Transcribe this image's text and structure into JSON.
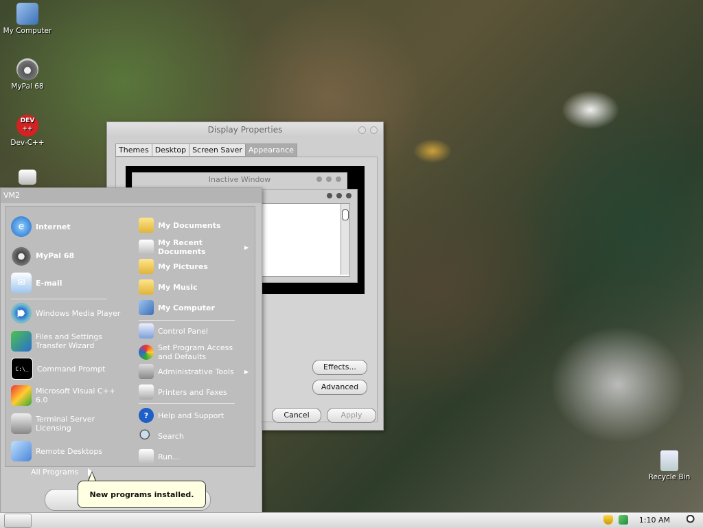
{
  "desktop": {
    "icons": [
      {
        "label": "My Computer",
        "icon": "computer-icon"
      },
      {
        "label": "MyPal 68",
        "icon": "raccoon-icon"
      },
      {
        "label": "Dev-C++",
        "icon": "devcpp-icon",
        "badge": "DEV ++"
      },
      {
        "label": "",
        "icon": "printer-icon"
      },
      {
        "label": "Recycle Bin",
        "icon": "recycle-bin-icon"
      }
    ]
  },
  "display_properties": {
    "title": "Display Properties",
    "tabs": [
      "Themes",
      "Desktop",
      "Screen Saver",
      "Appearance"
    ],
    "active_tab": "Appearance",
    "preview": {
      "inactive_title": "Inactive Window"
    },
    "buttons": {
      "effects": "Effects...",
      "advanced": "Advanced",
      "cancel": "Cancel",
      "apply": "Apply"
    }
  },
  "start_menu": {
    "user": "VM2",
    "pinned": [
      {
        "label": "Internet",
        "icon": "internet-explorer-icon"
      },
      {
        "label": "MyPal 68",
        "icon": "raccoon-icon"
      },
      {
        "label": "E-mail",
        "icon": "email-icon"
      }
    ],
    "recent": [
      {
        "label": "Windows Media Player",
        "icon": "media-player-icon"
      },
      {
        "label": "Files and Settings Transfer Wizard",
        "icon": "transfer-wizard-icon"
      },
      {
        "label": "Command Prompt",
        "icon": "command-prompt-icon",
        "glyph": "C:\\_"
      },
      {
        "label": "Microsoft Visual C++ 6.0",
        "icon": "visual-cpp-icon"
      },
      {
        "label": "Terminal Server Licensing",
        "icon": "terminal-server-icon"
      },
      {
        "label": "Remote Desktops",
        "icon": "remote-desktops-icon"
      }
    ],
    "all_programs": "All Programs",
    "right": [
      {
        "label": "My Documents",
        "icon": "folder-documents-icon"
      },
      {
        "label": "My Recent Documents",
        "icon": "recent-documents-icon",
        "submenu": true
      },
      {
        "label": "My Pictures",
        "icon": "folder-pictures-icon"
      },
      {
        "label": "My Music",
        "icon": "folder-music-icon"
      },
      {
        "label": "My Computer",
        "icon": "computer-icon"
      },
      {
        "label": "Control Panel",
        "icon": "control-panel-icon"
      },
      {
        "label": "Set Program Access and Defaults",
        "icon": "program-access-icon"
      },
      {
        "label": "Administrative Tools",
        "icon": "admin-tools-icon",
        "submenu": true
      },
      {
        "label": "Printers and Faxes",
        "icon": "printer-icon"
      },
      {
        "label": "Help and Support",
        "icon": "help-icon",
        "glyph": "?"
      },
      {
        "label": "Search",
        "icon": "search-icon"
      },
      {
        "label": "Run...",
        "icon": "run-icon"
      }
    ]
  },
  "balloon": {
    "text": "New programs installed."
  },
  "taskbar": {
    "clock": "1:10 AM",
    "start_glyph": ""
  }
}
